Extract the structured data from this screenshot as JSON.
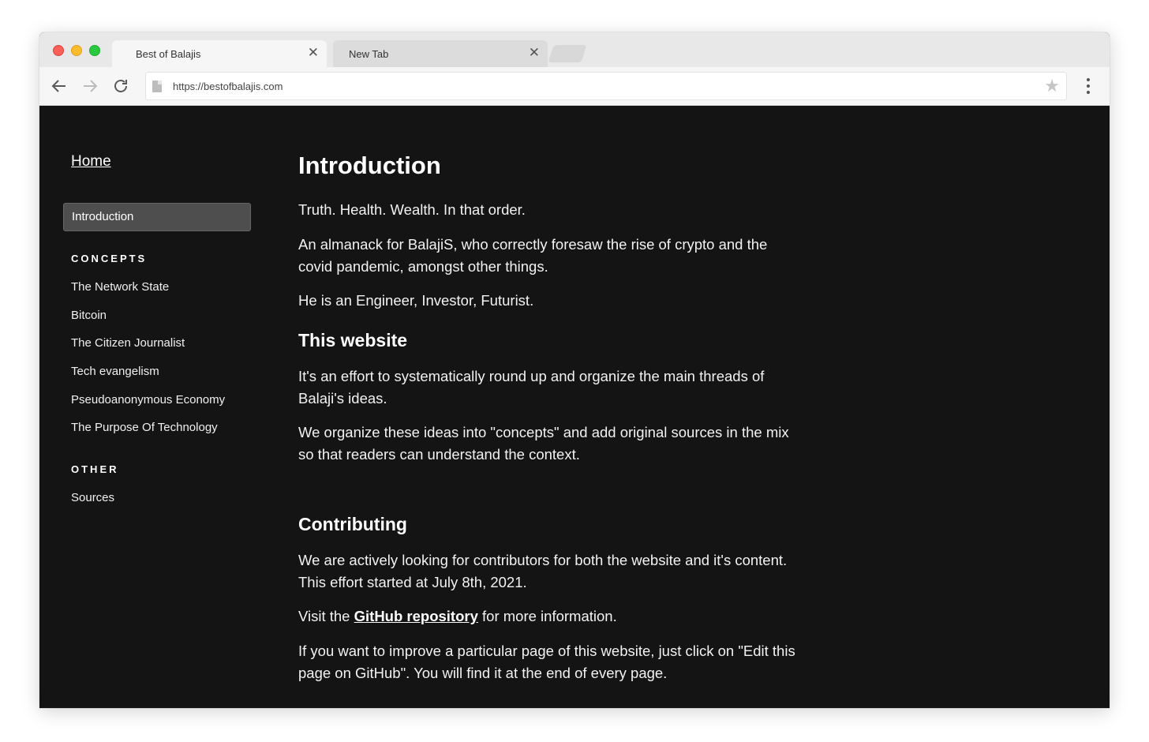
{
  "browser": {
    "tabs": [
      {
        "title": "Best of Balajis",
        "close": "✕",
        "active": true
      },
      {
        "title": "New Tab",
        "close": "✕",
        "active": false
      }
    ],
    "url": "https://bestofbalajis.com"
  },
  "sidebar": {
    "home": "Home",
    "active_item": "Introduction",
    "sections": [
      {
        "heading": "CONCEPTS",
        "items": [
          "The Network State",
          "Bitcoin",
          "The Citizen Journalist",
          "Tech evangelism",
          "Pseudoanonymous Economy",
          "The Purpose Of Technology"
        ]
      },
      {
        "heading": "OTHER",
        "items": [
          "Sources"
        ]
      }
    ]
  },
  "content": {
    "title": "Introduction",
    "intro": [
      "Truth. Health. Wealth. In that order.",
      "An almanack for BalajiS, who correctly foresaw the rise of crypto and the covid pandemic, amongst other things.",
      "He is an Engineer, Investor, Futurist."
    ],
    "website": {
      "heading": "This website",
      "paragraphs": [
        "It's an effort to systematically round up and organize the main threads of Balaji's ideas.",
        "We organize these ideas into \"concepts\" and add original sources in the mix so that readers can understand the context."
      ]
    },
    "contributing": {
      "heading": "Contributing",
      "p1": "We are actively looking for contributors for both the website and it's content. This effort started at July 8th, 2021.",
      "visit_prefix": "Visit the ",
      "visit_link": "GitHub repository",
      "visit_suffix": " for more information.",
      "p3": "If you want to improve a particular page of this website, just click on \"Edit this page on GitHub\". You will find it at the end of every page."
    }
  }
}
